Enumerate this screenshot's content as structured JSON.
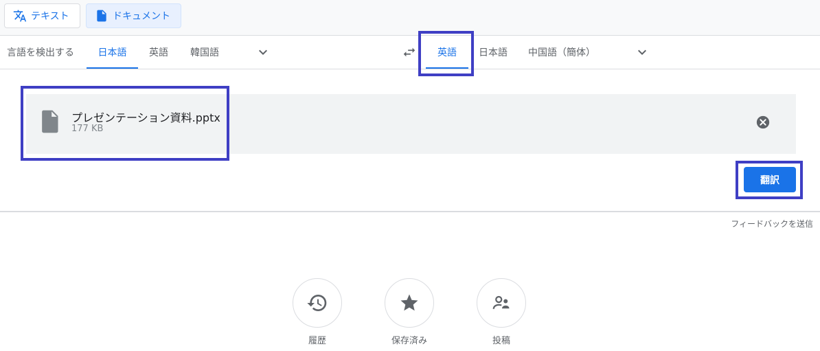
{
  "modes": {
    "text_label": "テキスト",
    "document_label": "ドキュメント"
  },
  "source_languages": {
    "detect": "言語を検出する",
    "items": [
      "日本語",
      "英語",
      "韓国語"
    ],
    "selected": "日本語"
  },
  "target_languages": {
    "items": [
      "英語",
      "日本語",
      "中国語（簡体）"
    ],
    "selected": "英語"
  },
  "file": {
    "name": "プレゼンテーション資料.pptx",
    "size": "177 KB"
  },
  "translate_label": "翻訳",
  "feedback_label": "フィードバックを送信",
  "bottom_actions": [
    {
      "label": "履歴",
      "icon": "history-icon"
    },
    {
      "label": "保存済み",
      "icon": "star-icon"
    },
    {
      "label": "投稿",
      "icon": "contribute-icon"
    }
  ],
  "colors": {
    "accent": "#1a73e8",
    "highlight": "#3f3fc4"
  }
}
